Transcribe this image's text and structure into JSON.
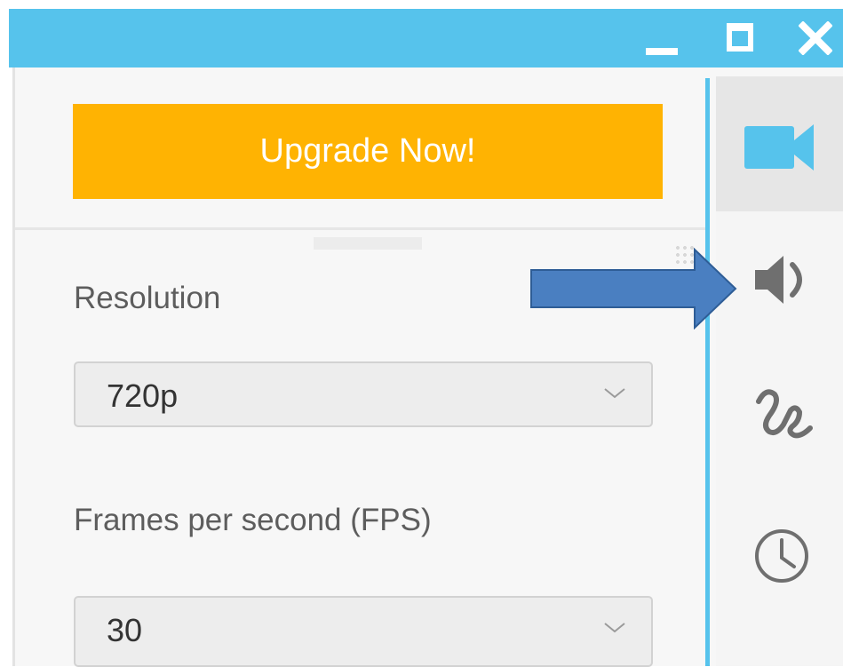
{
  "window": {
    "controls": {
      "minimize_icon": "minimize-icon",
      "maximize_icon": "maximize-icon",
      "close_icon": "close-icon"
    },
    "title_bar_color": "#56c3ec"
  },
  "upgrade": {
    "label": "Upgrade Now!",
    "color": "#ffb302"
  },
  "settings": {
    "resolution": {
      "label": "Resolution",
      "selected": "720p"
    },
    "fps": {
      "label": "Frames per second (FPS)",
      "selected": "30"
    }
  },
  "sidebar": {
    "items": [
      {
        "icon": "video-camera-icon",
        "active": true
      },
      {
        "icon": "speaker-icon",
        "active": false
      },
      {
        "icon": "draw-squiggle-icon",
        "active": false
      },
      {
        "icon": "clock-icon",
        "active": false
      }
    ],
    "accent_color": "#56c3ec"
  },
  "annotation": {
    "arrow_icon": "pointer-arrow-icon",
    "arrow_color": "#4a7fc1"
  }
}
